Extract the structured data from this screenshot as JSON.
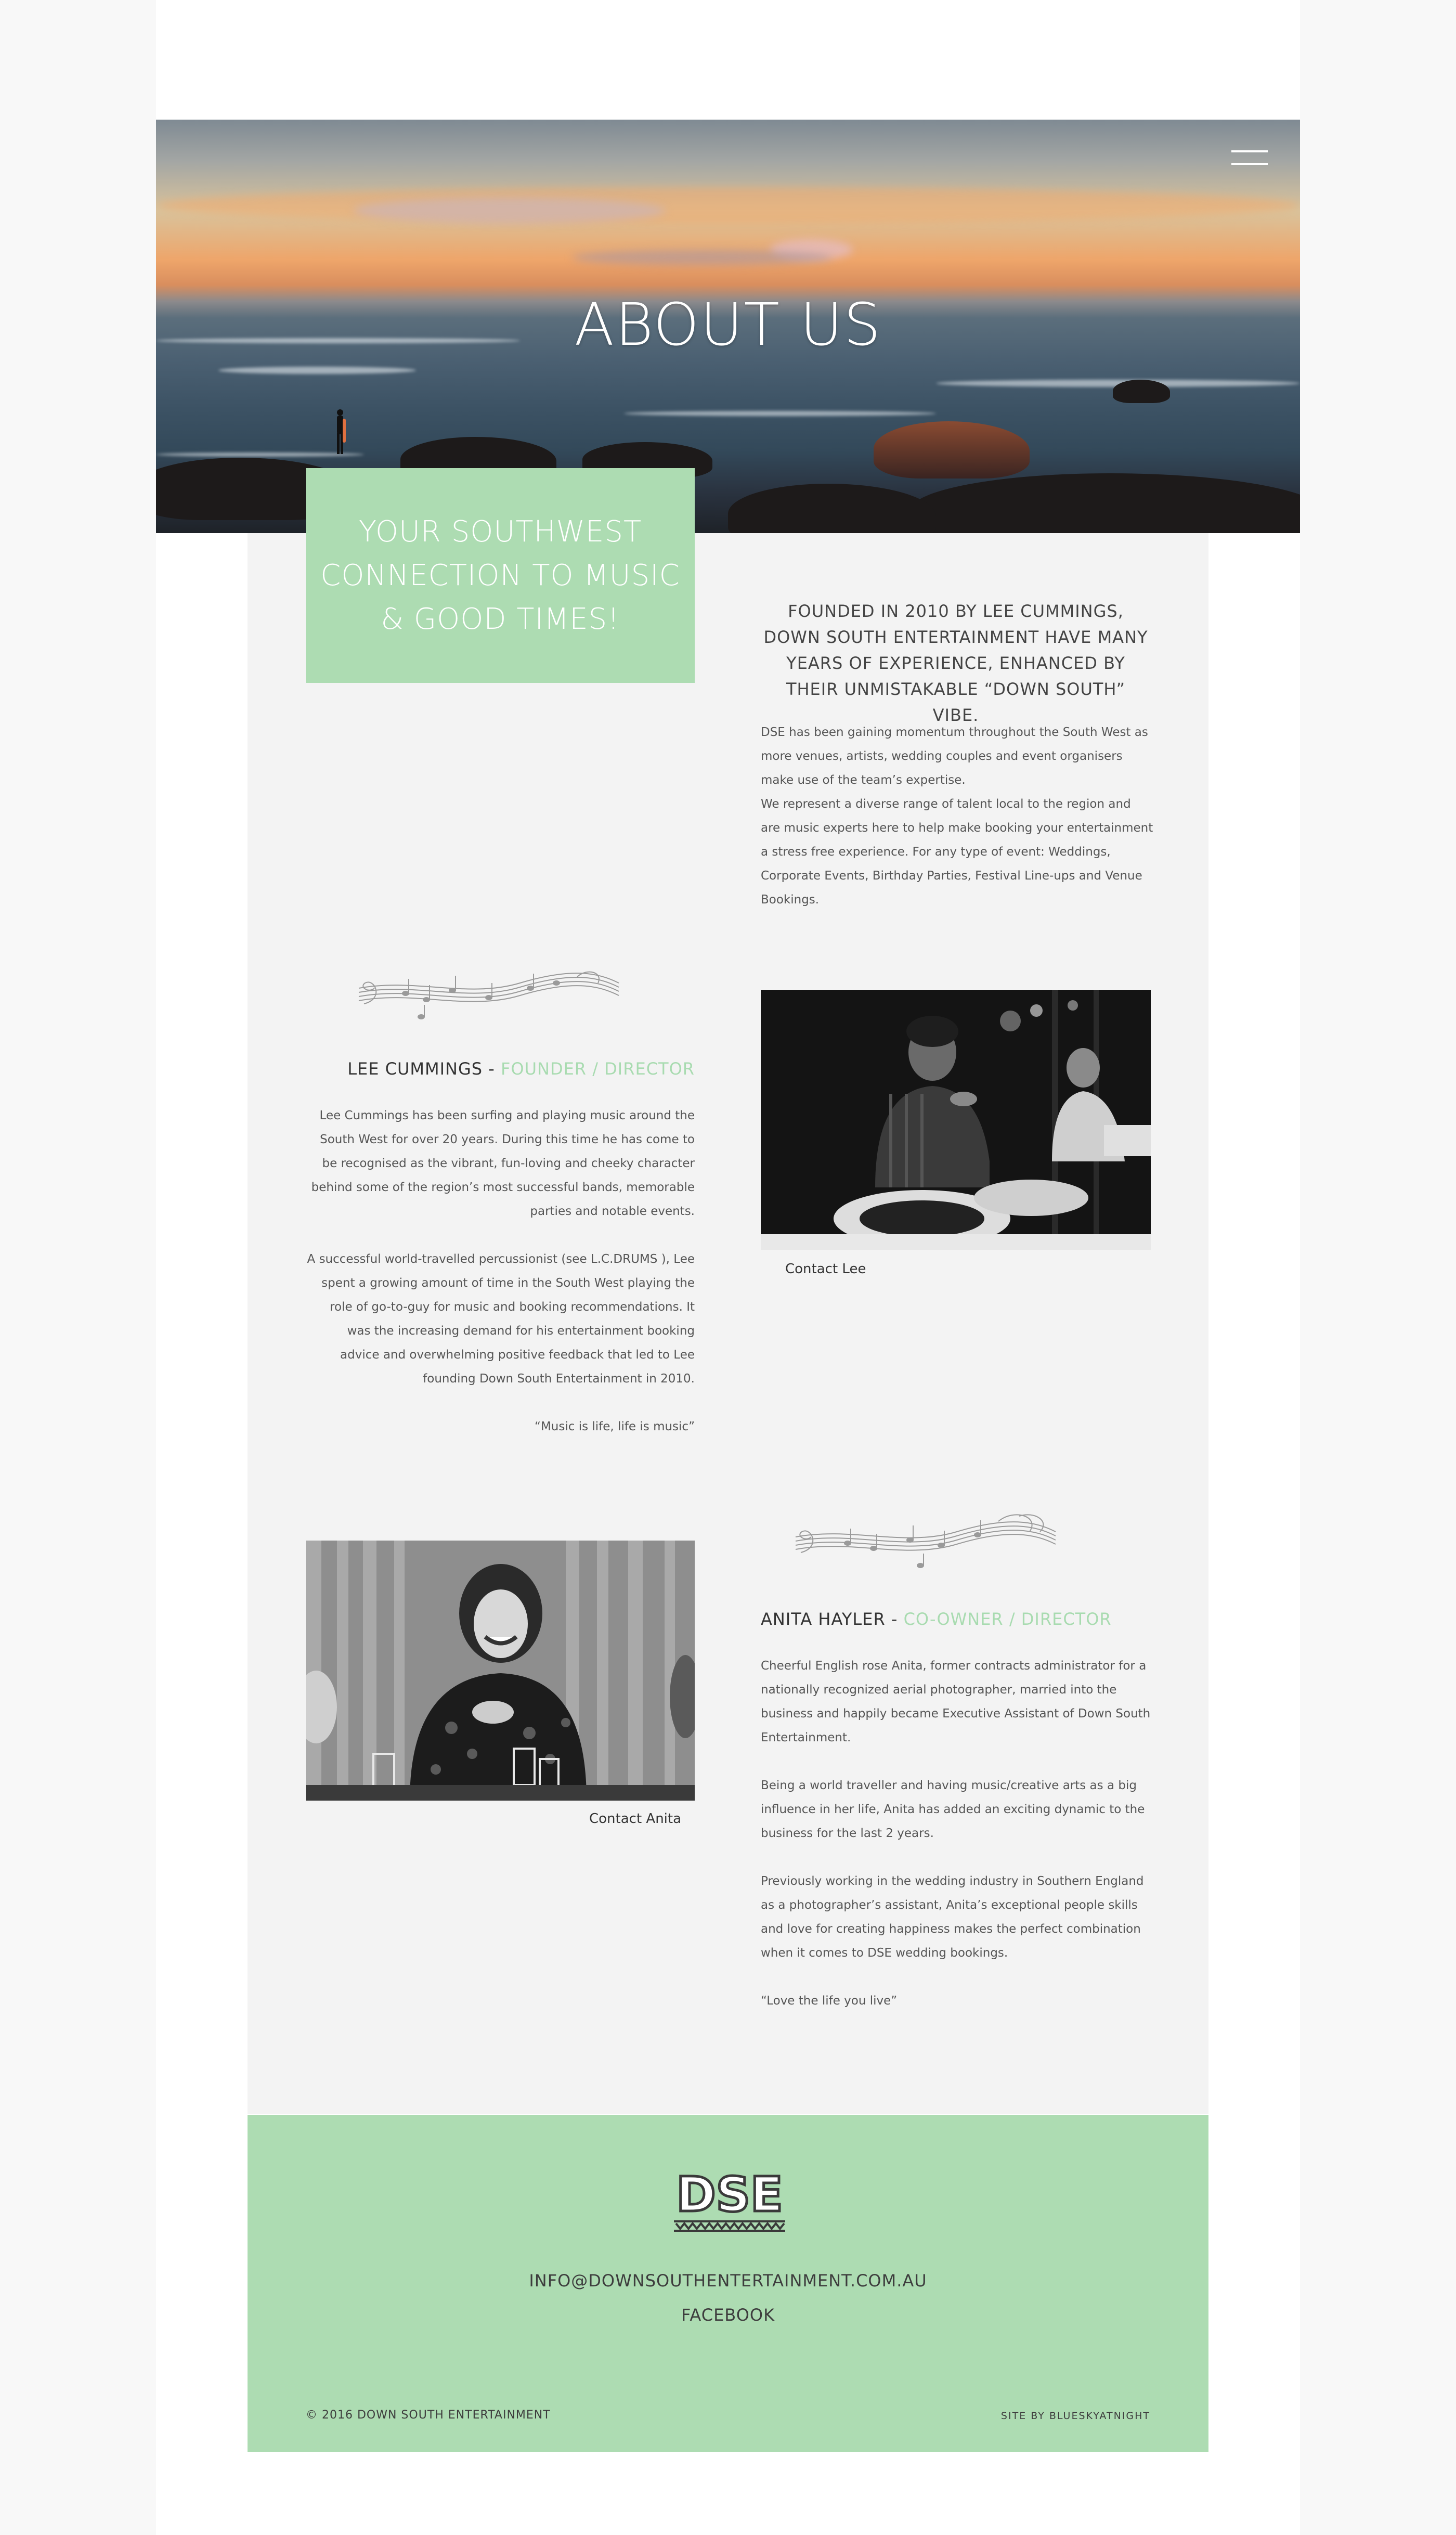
{
  "hero": {
    "title": "ABOUT US",
    "menu_icon": "hamburger-menu-icon"
  },
  "tagline": "YOUR SOUTHWEST\nCONNECTION TO MUSIC\n& GOOD TIMES!",
  "founded": "FOUNDED IN 2010 BY LEE CUMMINGS, DOWN SOUTH ENTERTAINMENT HAVE MANY YEARS OF EXPERIENCE, ENHANCED BY THEIR UNMISTAKABLE “DOWN SOUTH” VIBE.",
  "intro": [
    "DSE has been gaining momentum throughout the South West as more venues, artists, wedding couples and event organisers make use of the team’s expertise.",
    "We represent a diverse range of talent local to the region and are music experts here to help make booking your entertainment a stress free experience. For any type of event: Weddings, Corporate Events, Birthday Parties, Festival Line-ups and Venue Bookings."
  ],
  "lee": {
    "name": "LEE CUMMINGS - ",
    "role": "FOUNDER / DIRECTOR",
    "bio": [
      "Lee Cummings has been surfing and playing music around the South West for over 20 years. During this time he has come to be recognised as the vibrant, fun-loving and cheeky character behind some of the region’s most successful bands, memorable parties and notable events.",
      "A successful world-travelled percussionist (see L.C.DRUMS ), Lee spent a growing amount of time in the South West playing the role of go-to-guy for music and booking recommendations. It was the increasing demand for his entertainment booking advice and overwhelming positive feedback that led to Lee founding Down South Entertainment in 2010.",
      "“Music is life, life is music”"
    ],
    "contact": "Contact Lee"
  },
  "anita": {
    "name": "ANITA HAYLER - ",
    "role": "CO-OWNER / DIRECTOR",
    "bio": [
      "Cheerful English rose Anita, former contracts administrator for a nationally recognized aerial photographer, married into the business and happily became Executive Assistant of Down South Entertainment.",
      "Being a world traveller and having music/creative arts as a big influence in her life, Anita has added an exciting dynamic to the business for the last 2 years.",
      "Previously working in the wedding industry in Southern England as a photographer’s assistant, Anita’s exceptional people skills and love for creating happiness makes the perfect combination when it comes to DSE wedding bookings.",
      "“Love the life you live”"
    ],
    "contact": "Contact Anita"
  },
  "footer": {
    "logo_text": "DSE",
    "email": "INFO@DOWNSOUTHENTERTAINMENT.COM.AU",
    "facebook": "FACEBOOK",
    "copyright": "© 2016 DOWN SOUTH ENTERTAINMENT",
    "credit": "SITE BY BLUESKYATNIGHT"
  },
  "colors": {
    "accent_green": "#addcb2",
    "role_green": "#a8dbb0",
    "panel_grey": "#f3f3f3"
  }
}
